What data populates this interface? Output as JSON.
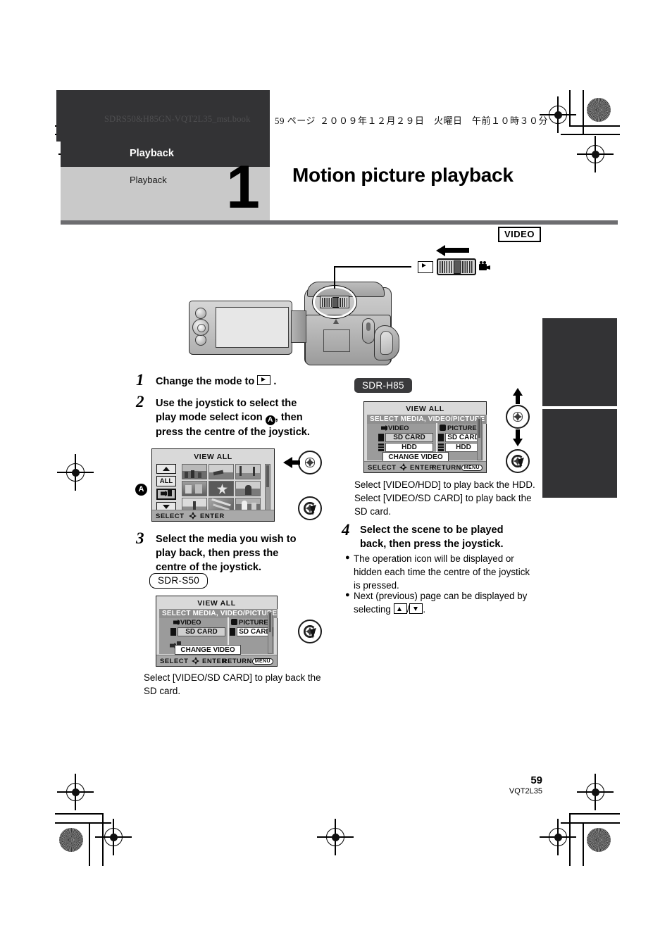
{
  "print_header": {
    "file_name": "SDRS50&H85GN-VQT2L35_mst.book",
    "page_label": "59 ページ",
    "date_label": "２００９年１２月２９日　火曜日　午前１０時３０分"
  },
  "chapter": {
    "section_label": "Playback",
    "sub_label": "Playback",
    "number": "1"
  },
  "page_title": "Motion picture playback",
  "badges": {
    "video": "VIDEO",
    "model_h85": "SDR-H85",
    "model_s50": "SDR-S50"
  },
  "steps": [
    {
      "num": "1",
      "text_a": "Change the mode to",
      "text_b": "."
    },
    {
      "num": "2",
      "text_a": "Use the joystick to select the",
      "text_b": "play mode select icon",
      "text_c": ", then",
      "text_d": "press the centre of the joystick."
    },
    {
      "num": "3",
      "text_a": "Select the media you wish to",
      "text_b": "play back, then press the",
      "text_c": "centre of the joystick."
    },
    {
      "num": "4",
      "text_a": "Select the scene to be played",
      "text_b": "back, then press the joystick."
    }
  ],
  "notes": {
    "s50_caption_l1": "Select [VIDEO/SD CARD] to play back the",
    "s50_caption_l2": "SD card.",
    "h85_caption_l1": "Select [VIDEO/HDD] to play back the HDD.",
    "h85_caption_l2": "Select [VIDEO/SD CARD] to play back the",
    "h85_caption_l3": "SD card.",
    "bullet1_l1": "The operation icon will be displayed or",
    "bullet1_l2": "hidden each time the centre of the joystick",
    "bullet1_l3": "is pressed.",
    "bullet2_l1": "Next (previous) page can be displayed by",
    "bullet2_l2": "selecting",
    "bullet2_l3": "."
  },
  "lcd_view_all": {
    "title": "VIEW ALL",
    "btn_all": "ALL",
    "status_select": "SELECT",
    "status_enter": "ENTER",
    "callout_a": "A"
  },
  "lcd_media_h85": {
    "title": "VIEW ALL",
    "header": "SELECT MEDIA, VIDEO/PICTURE",
    "col_video": "VIDEO",
    "col_picture": "PICTURE",
    "video_rows": [
      "SD CARD",
      "HDD"
    ],
    "picture_rows": [
      "SD CARD",
      "HDD"
    ],
    "change_btn": "CHANGE VIDEO",
    "status_select": "SELECT",
    "status_enter": "ENTER",
    "status_return": "RETURN",
    "status_return_chip": "MENU"
  },
  "lcd_media_s50": {
    "title": "VIEW ALL",
    "header": "SELECT MEDIA, VIDEO/PICTURE",
    "col_video": "VIDEO",
    "col_picture": "PICTURE",
    "video_rows": [
      "SD CARD"
    ],
    "picture_rows": [
      "SD CARD"
    ],
    "change_btn": "CHANGE VIDEO",
    "status_select": "SELECT",
    "status_enter": "ENTER",
    "status_return": "RETURN",
    "status_return_chip": "MENU"
  },
  "footer": {
    "page_number": "59",
    "doc_code": "VQT2L35"
  },
  "colors": {
    "dark_bar": "#333335",
    "chapter_grey": "#c9c9c9",
    "rule_grey": "#6d6d70",
    "lcd_grey": "#d9d9d9"
  }
}
